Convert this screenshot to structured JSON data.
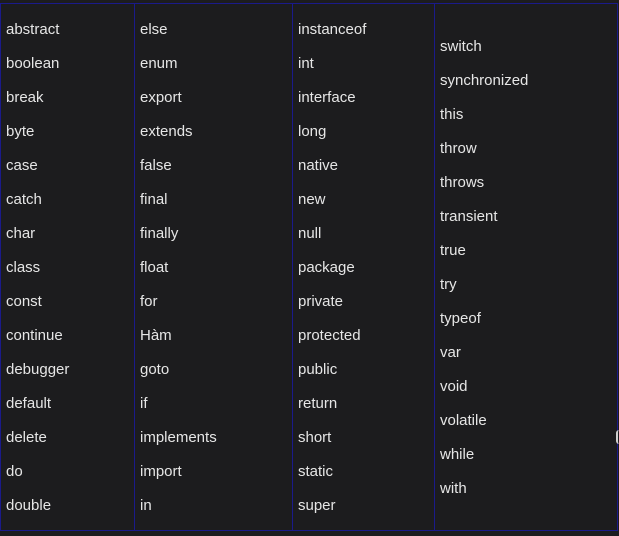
{
  "columns": [
    [
      "abstract",
      "boolean",
      "break",
      "byte",
      "case",
      "catch",
      "char",
      "class",
      "const",
      "continue",
      "debugger",
      "default",
      "delete",
      "do",
      "double"
    ],
    [
      "else",
      "enum",
      "export",
      "extends",
      "false",
      "final",
      "finally",
      "float",
      "for",
      "Hàm",
      "goto",
      "if",
      "implements",
      "import",
      "in"
    ],
    [
      "instanceof",
      "int",
      "interface",
      "long",
      "native",
      "new",
      "null",
      "package",
      "private",
      "protected",
      "public",
      "return",
      "short",
      "static",
      "super"
    ],
    [
      "switch",
      "synchronized",
      "this",
      "throw",
      "throws",
      "transient",
      "true",
      "try",
      "typeof",
      "var",
      "void",
      "volatile",
      "while",
      "with"
    ]
  ]
}
